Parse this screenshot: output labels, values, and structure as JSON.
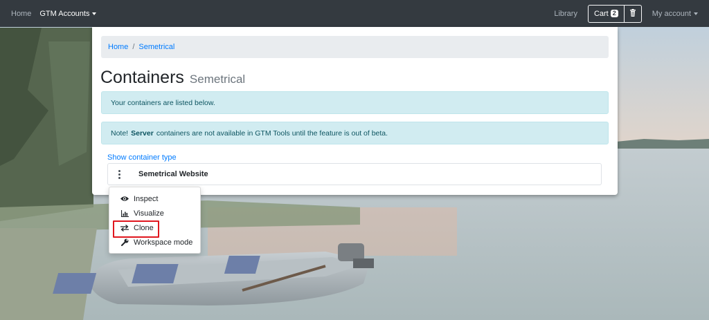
{
  "navbar": {
    "home": "Home",
    "accounts_menu": "GTM Accounts",
    "library": "Library",
    "cart_label": "Cart",
    "cart_count": "2",
    "account_menu": "My account"
  },
  "breadcrumb": {
    "home": "Home",
    "separator": "/",
    "current": "Semetrical"
  },
  "page": {
    "title": "Containers",
    "subtitle": "Semetrical"
  },
  "alerts": {
    "info": "Your containers are listed below.",
    "note_prefix": "Note!",
    "note_bold": "Server",
    "note_rest": "containers are not available in GTM Tools until the feature is out of beta."
  },
  "containers": {
    "toggle_label": "Show container type",
    "items": [
      {
        "name": "Semetrical Website"
      }
    ]
  },
  "menu": {
    "items": [
      {
        "label": "Inspect",
        "icon": "eye-icon"
      },
      {
        "label": "Visualize",
        "icon": "chart-icon"
      },
      {
        "label": "Clone",
        "icon": "exchange-icon"
      },
      {
        "label": "Workspace mode",
        "icon": "wrench-icon"
      }
    ],
    "highlighted": "Clone"
  },
  "colors": {
    "navbar": "#343a40",
    "link": "#007bff",
    "alert_bg": "#d1ecf1",
    "highlight": "#e0161e"
  }
}
